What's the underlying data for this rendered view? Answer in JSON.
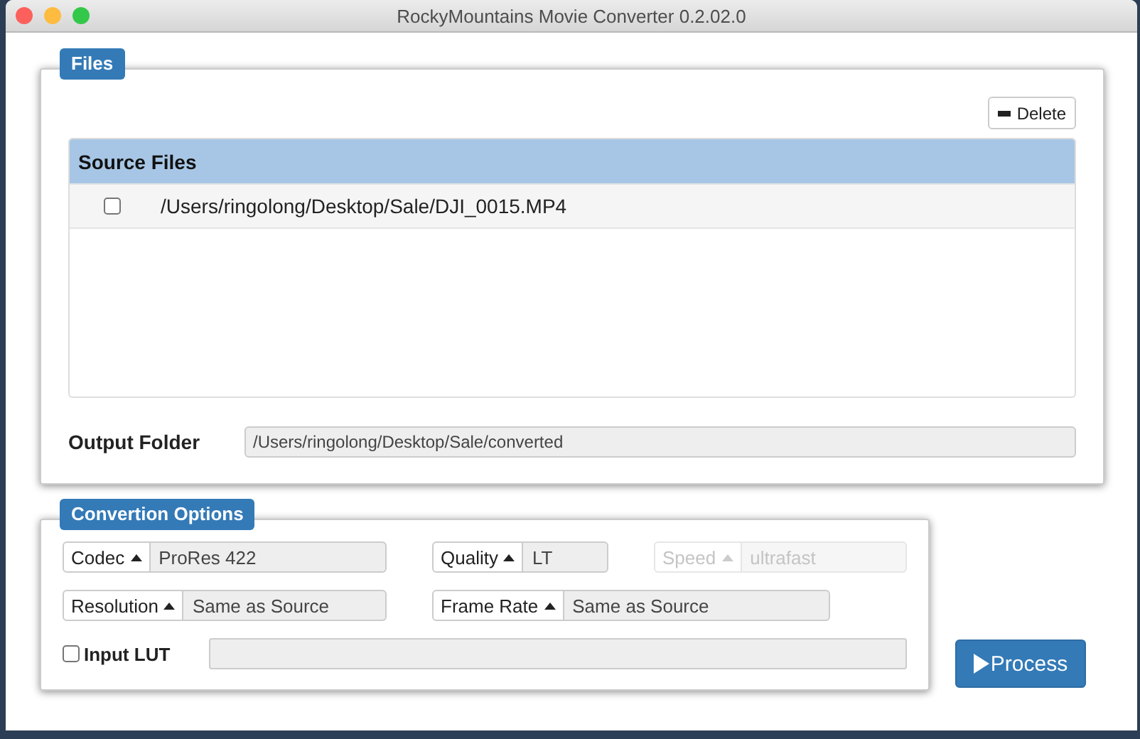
{
  "window": {
    "title": "RockyMountains Movie Converter 0.2.02.0"
  },
  "files": {
    "legend": "Files",
    "delete_button": "Delete",
    "table": {
      "header": "Source Files",
      "rows": [
        {
          "path": "/Users/ringolong/Desktop/Sale/DJI_0015.MP4",
          "checked": false
        }
      ]
    },
    "output_folder": {
      "label": "Output Folder",
      "value": "/Users/ringolong/Desktop/Sale/converted"
    }
  },
  "options": {
    "legend": "Convertion Options",
    "selects": [
      {
        "label": "Codec",
        "value": "ProRes 422",
        "disabled": false
      },
      {
        "label": "Quality",
        "value": "LT",
        "disabled": false
      },
      {
        "label": "Speed",
        "value": "ultrafast",
        "disabled": true
      },
      {
        "label": "Resolution",
        "value": "Same as Source",
        "disabled": false
      },
      {
        "label": "Frame Rate",
        "value": "Same as Source",
        "disabled": false
      }
    ],
    "input_lut": {
      "label": "Input LUT",
      "checked": false
    }
  },
  "process_button": "Process"
}
